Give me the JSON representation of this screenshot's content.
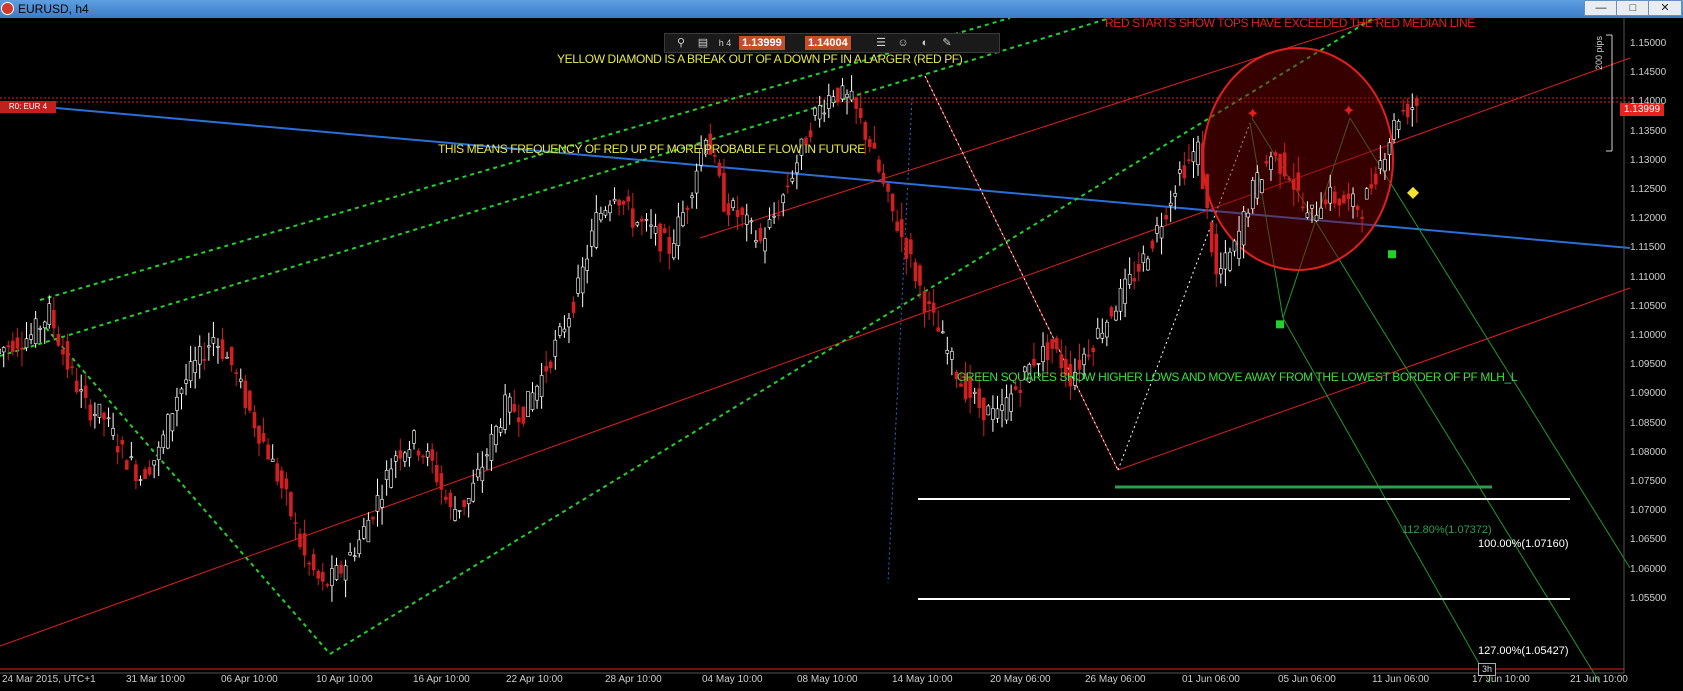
{
  "window": {
    "title": "EURUSD, h4"
  },
  "toolbar": {
    "bid": "1.13999",
    "ask": "1.14004",
    "timeframe": "h 4",
    "icons": [
      "search-icon",
      "chart-icon",
      "timeframe-icon",
      "list-icon",
      "face-icon",
      "mode-icon",
      "edit-icon"
    ]
  },
  "annotations": {
    "top_red": "RED STARTS SHOW TOPS HAVE EXCEEDED THE RED MEDIAN LINE",
    "yellow_1": "YELLOW DIAMOND IS A BREAK OUT OF A DOWN PF IN A LARGER (RED PF)",
    "yellow_2": "THIS MEANS FREQUENCY OF RED UP PF MORE PROBABLE FLOW IN FUTURE",
    "green": "GREEN SQUARES SHOW HIGHER LOWS AND MOVE AWAY FROM THE LOWEST BORDER OF PF MLH_L"
  },
  "fib_levels": [
    {
      "label": "112.80%(1.07372)",
      "price": 1.07372,
      "color": "#2e9e4a"
    },
    {
      "label": "100.00%(1.07160)",
      "price": 1.0716,
      "color": "#ffffff"
    },
    {
      "label": "127.00%(1.05427)",
      "price": 1.05427,
      "color": "#ffffff"
    }
  ],
  "price_axis": {
    "labels": [
      "1.15000",
      "1.14500",
      "1.14000",
      "1.13500",
      "1.13000",
      "1.12500",
      "1.12000",
      "1.11500",
      "1.11000",
      "1.10500",
      "1.10000",
      "1.09500",
      "1.09000",
      "1.08500",
      "1.08000",
      "1.07500",
      "1.07000",
      "1.06500",
      "1.06000",
      "1.05500"
    ],
    "current_price": "1.13999",
    "left_tag": "R0: EUR 4",
    "pips_label": "200 pips"
  },
  "time_axis": {
    "labels": [
      "24 Mar 2015, UTC+1",
      "31 Mar 10:00",
      "06 Apr 10:00",
      "10 Apr 10:00",
      "16 Apr 10:00",
      "22 Apr 10:00",
      "28 Apr 10:00",
      "04 May 10:00",
      "08 May 10:00",
      "14 May 10:00",
      "20 May 06:00",
      "26 May 06:00",
      "01 Jun 06:00",
      "05 Jun 06:00",
      "11 Jun 06:00",
      "17 Jun 10:00",
      "21 Jun 10:00"
    ],
    "scale_box": "3h"
  },
  "colors": {
    "background": "#000000",
    "red_line": "#e0201e",
    "green_dotted": "#22d12a",
    "blue_line": "#2a6fd6",
    "yellow_text": "#e8e84a",
    "green_text": "#3fdc3f",
    "candle_up": "#ffffff",
    "candle_down": "#d21f1f"
  },
  "chart_data": {
    "type": "line",
    "title": "",
    "xlabel": "",
    "ylabel": "",
    "ylim": [
      1.0525,
      1.1525
    ],
    "x_labels": [
      "24 Mar 2015, UTC+1",
      "31 Mar 10:00",
      "06 Apr 10:00",
      "10 Apr 10:00",
      "16 Apr 10:00",
      "22 Apr 10:00",
      "28 Apr 10:00",
      "04 May 10:00",
      "08 May 10:00",
      "14 May 10:00",
      "20 May 06:00",
      "26 May 06:00",
      "01 Jun 06:00",
      "05 Jun 06:00",
      "11 Jun 06:00",
      "17 Jun 10:00",
      "21 Jun 10:00"
    ],
    "series": [
      {
        "values": [
          1.099,
          1.1,
          1.104,
          1.095,
          1.088,
          1.086,
          1.08,
          1.076,
          1.08,
          1.09,
          1.095,
          1.1,
          1.095,
          1.087,
          1.08,
          1.072,
          1.062,
          1.057,
          1.06,
          1.065,
          1.072,
          1.08,
          1.082,
          1.078,
          1.07,
          1.072,
          1.08,
          1.088,
          1.087,
          1.093,
          1.1,
          1.108,
          1.12,
          1.125,
          1.12,
          1.118,
          1.115,
          1.123,
          1.135,
          1.123,
          1.12,
          1.116,
          1.122,
          1.13,
          1.138,
          1.142,
          1.14,
          1.133,
          1.123,
          1.115,
          1.106,
          1.099,
          1.092,
          1.088,
          1.086,
          1.091,
          1.096,
          1.098,
          1.093,
          1.098,
          1.103,
          1.108,
          1.113,
          1.12,
          1.128,
          1.132,
          1.11,
          1.115,
          1.125,
          1.131,
          1.128,
          1.12,
          1.124,
          1.123,
          1.122,
          1.13,
          1.138,
          1.14
        ]
      }
    ],
    "markers": [
      {
        "type": "red-star",
        "x_index": 0,
        "price": 1.138
      },
      {
        "type": "red-star",
        "x_index": 1,
        "price": 1.1385
      },
      {
        "type": "green-square",
        "x_index": 2,
        "price": 1.102
      },
      {
        "type": "green-square",
        "x_index": 3,
        "price": 1.114
      },
      {
        "type": "yellow-diamond",
        "x_index": 4,
        "price": 1.1245
      }
    ],
    "grid": false,
    "legend": "none"
  }
}
